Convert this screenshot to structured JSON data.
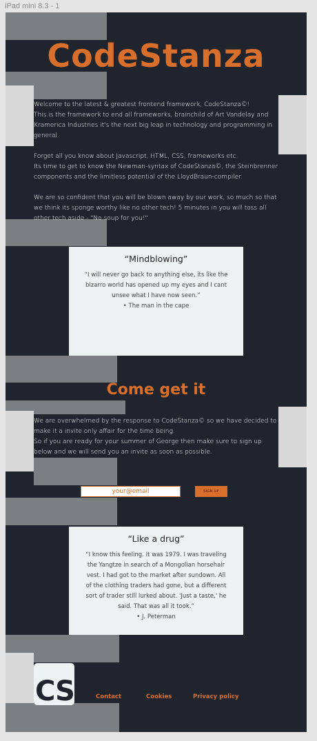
{
  "frame": {
    "label": "iPad mini 8.3 - 1"
  },
  "brand": {
    "name": "CodeStanza",
    "footer_logo": "CS"
  },
  "intro": {
    "p1_lines": [
      "Welcome to the latest & greatest frontend framework, CodeStanza©!",
      "This is the framework to end all frameworks, brainchild of Art Vandelay and",
      "Kramerica Industries it's the next big leap in technology and programming in",
      "general."
    ],
    "p2_lines": [
      "Forget all you know about Javascript, HTML, CSS, frameworks etc.",
      "Its time to get to know the Newman-syntax of CodeStanza©, the Steinbrenner",
      "components  and the limitless potential of the LloydBraun-compiler."
    ],
    "p3_lines": [
      "We are so confident that you will be blown away by our work, so much so that",
      "we think its sponge worthy like no other tech! 5 minutes in you will toss all",
      "other tech aside - \"No soup for you!\""
    ]
  },
  "quote1": {
    "title": "“Mindblowing”",
    "lines": [
      "“I will never go back to anything else, its like the",
      "bizarro world has opened up my eyes and I cant",
      "unsee what I have now seen.”"
    ],
    "author": "•  The man in the cape"
  },
  "signup": {
    "heading": "Come get it",
    "p1_lines": [
      "We are overwhelmed by the response to CodeStanza© so we have decided to",
      "make it a invite only affair for the time being.",
      "So if you are ready for your summer of George then make sure to sign up",
      "below and we will send you an invite as soon as possible."
    ],
    "email_placeholder": "your@email",
    "button_label": "SIGN UP"
  },
  "quote2": {
    "title": "“Like a drug”",
    "lines": [
      "“I know this feeling. It was 1979. I was traveling",
      "the Yangtze in search of a Mongolian horsehair",
      "vest. I had got to the market after sundown. All",
      "of the clothing traders had gone, but a different",
      "sort of trader still lurked about. 'Just a taste,' he",
      "said. That was all it took.”"
    ],
    "author": "•  J. Peterman"
  },
  "footer": {
    "links": [
      "Contact",
      "Cookies",
      "Privacy policy"
    ]
  },
  "colors": {
    "background": "#1f242d",
    "accent": "#d96f2c",
    "card": "#edf3f3",
    "block_gray": "#7c7f82",
    "block_light": "#d9d9d9"
  }
}
